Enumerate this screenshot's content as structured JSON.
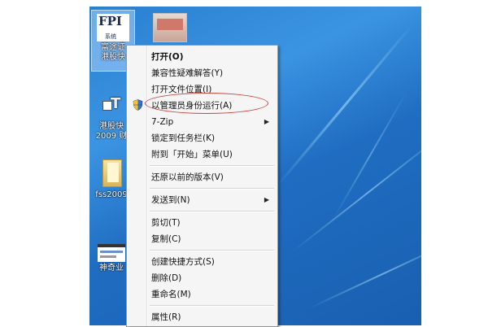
{
  "desktop": {
    "icons": [
      {
        "label": "富途证\n港股快",
        "logo": "FPI",
        "sub": "系统"
      },
      {
        "label": "港股快\n2009 财",
        "logo": "T"
      },
      {
        "label": "fss2009"
      },
      {
        "label": "神奇业"
      }
    ]
  },
  "menu": {
    "items": [
      {
        "label": "打开(O)",
        "bold": true
      },
      {
        "label": "兼容性疑难解答(Y)"
      },
      {
        "label": "打开文件位置(I)"
      },
      {
        "label": "以管理员身份运行(A)",
        "icon": "uac-shield-icon",
        "highlighted": true
      },
      {
        "label": "7-Zip",
        "submenu": true
      },
      {
        "label": "锁定到任务栏(K)"
      },
      {
        "label": "附到「开始」菜单(U)"
      },
      {
        "label": "还原以前的版本(V)"
      },
      {
        "label": "发送到(N)",
        "submenu": true
      },
      {
        "label": "剪切(T)"
      },
      {
        "label": "复制(C)"
      },
      {
        "label": "创建快捷方式(S)"
      },
      {
        "label": "删除(D)"
      },
      {
        "label": "重命名(M)"
      },
      {
        "label": "属性(R)"
      }
    ]
  },
  "colors": {
    "annotation": "#c8463c",
    "desktop": "#2a7fd0",
    "menu_bg": "#f5f5f5"
  }
}
